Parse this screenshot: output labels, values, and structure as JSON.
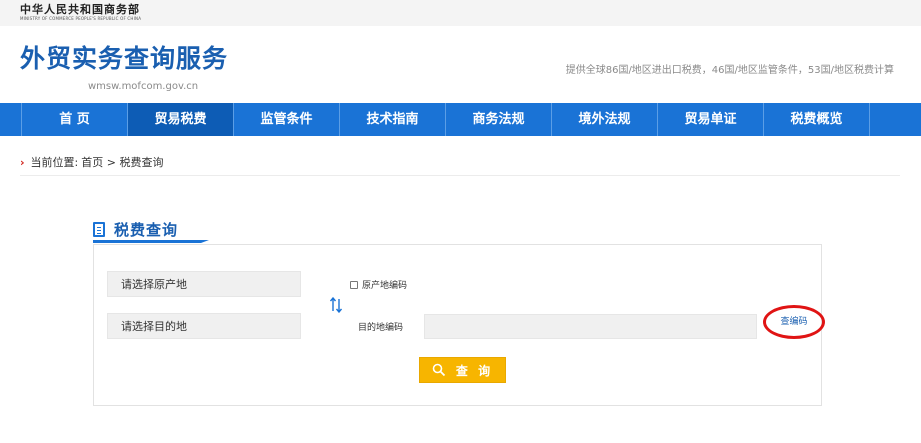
{
  "ministry": {
    "name_cn": "中华人民共和国商务部",
    "name_en": "MINISTRY OF COMMERCE PEOPLE'S REPUBLIC OF CHINA"
  },
  "header": {
    "title": "外贸实务查询服务",
    "url": "wmsw.mofcom.gov.cn",
    "tagline": "提供全球86国/地区进出口税费，46国/地区监管条件，53国/地区税费计算"
  },
  "nav": {
    "items": [
      {
        "label": "首 页"
      },
      {
        "label": "贸易税费"
      },
      {
        "label": "监管条件"
      },
      {
        "label": "技术指南"
      },
      {
        "label": "商务法规"
      },
      {
        "label": "境外法规"
      },
      {
        "label": "贸易单证"
      },
      {
        "label": "税费概览"
      }
    ],
    "active_index": 1
  },
  "breadcrumb": {
    "prefix": "当前位置:",
    "path": "首页 > 税费查询"
  },
  "section": {
    "title": "税费查询"
  },
  "form": {
    "origin_select": "请选择原产地",
    "dest_select": "请选择目的地",
    "origin_code_label": "原产地编码",
    "dest_code_label": "目的地编码",
    "dest_code_value": "",
    "lookup_link": "查编码",
    "query_button": "查 询"
  },
  "colors": {
    "brand_blue": "#1a73d6",
    "title_blue": "#1a5fb0",
    "button_yellow": "#f7b500",
    "highlight_red": "#e01414"
  }
}
